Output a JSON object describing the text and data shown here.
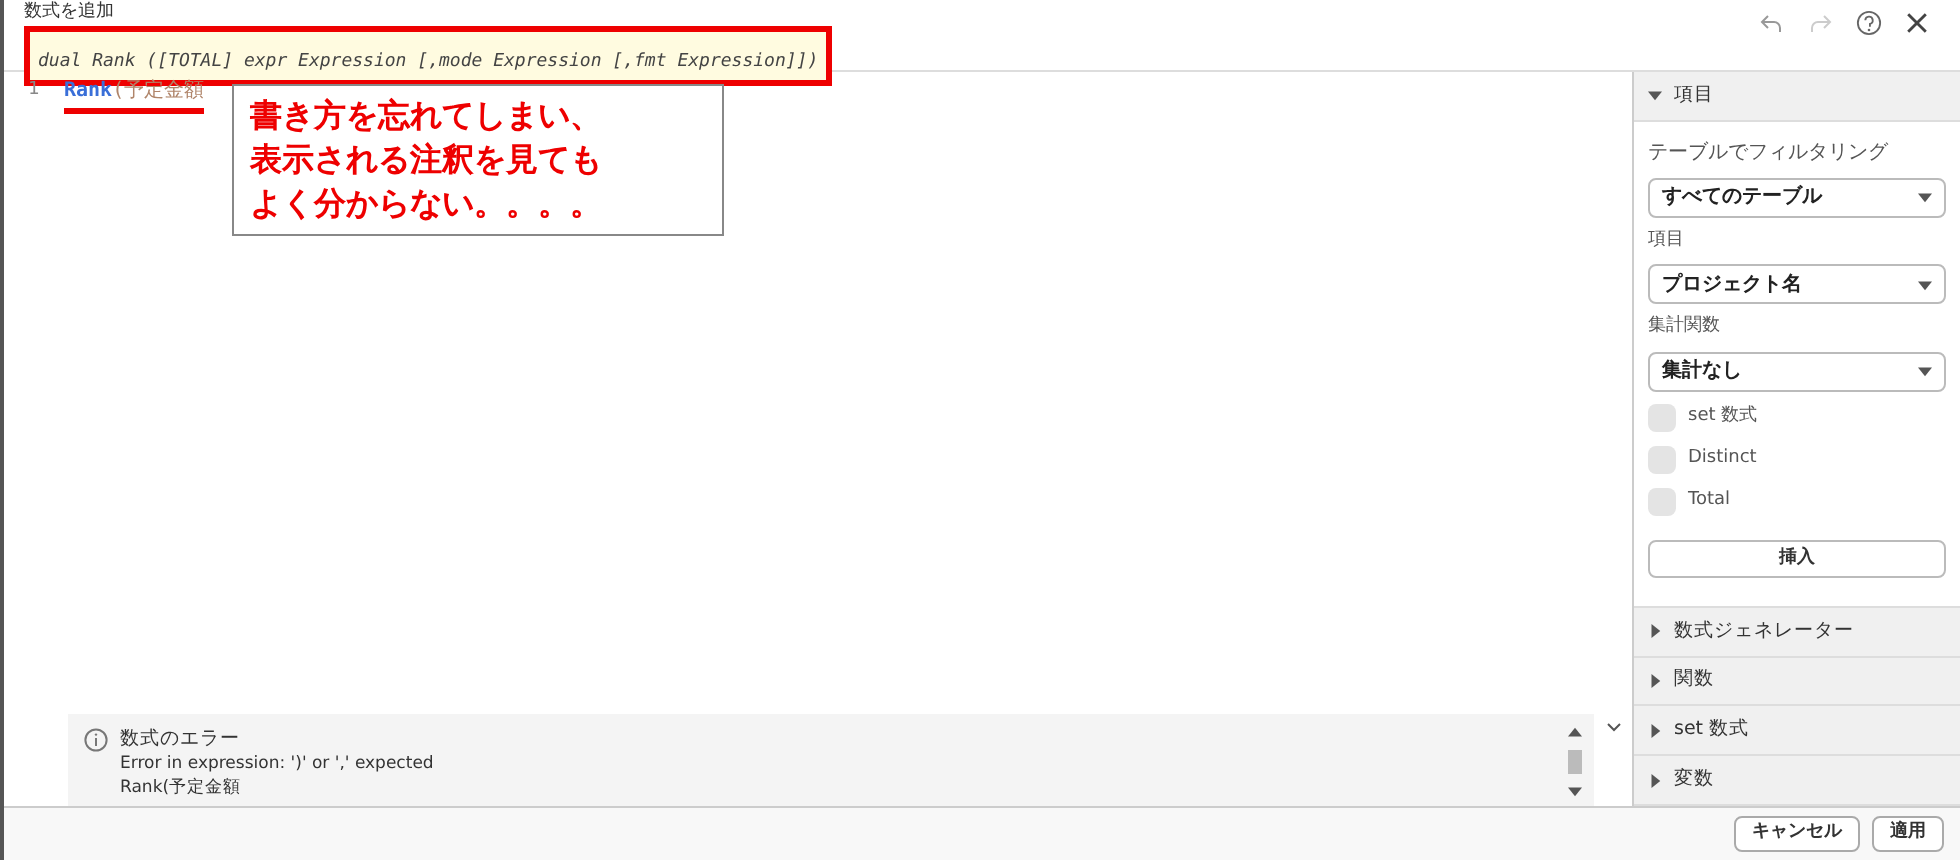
{
  "dialog": {
    "title": "数式を追加"
  },
  "editor": {
    "tooltip": "dual Rank ([TOTAL] expr Expression [,mode Expression [,fmt Expression]])",
    "line_number": "1",
    "function_name": "Rank",
    "argument": "(予定金額"
  },
  "annotation": {
    "lines": [
      "書き方を忘れてしまい、",
      "表示される注釈を見ても",
      "よく分からない。。。。"
    ]
  },
  "error_panel": {
    "title": "数式のエラー",
    "message": "Error in expression: ')' or ',' expected",
    "detail": "Rank(予定金額"
  },
  "sidebar": {
    "sections": [
      {
        "label": "項目",
        "expanded": true
      },
      {
        "label": "数式ジェネレーター",
        "expanded": false
      },
      {
        "label": "関数",
        "expanded": false
      },
      {
        "label": "set 数式",
        "expanded": false
      },
      {
        "label": "変数",
        "expanded": false
      }
    ],
    "filter_label": "テーブルでフィルタリング",
    "filter_value": "すべてのテーブル",
    "field_label": "項目",
    "field_value": "プロジェクト名",
    "aggregation_label": "集計関数",
    "aggregation_value": "集計なし",
    "options": [
      {
        "label": "set 数式",
        "checked": false
      },
      {
        "label": "Distinct",
        "checked": false
      },
      {
        "label": "Total",
        "checked": false
      }
    ],
    "insert_button": "挿入"
  },
  "buttons": [
    "キャンセル",
    "適用"
  ]
}
